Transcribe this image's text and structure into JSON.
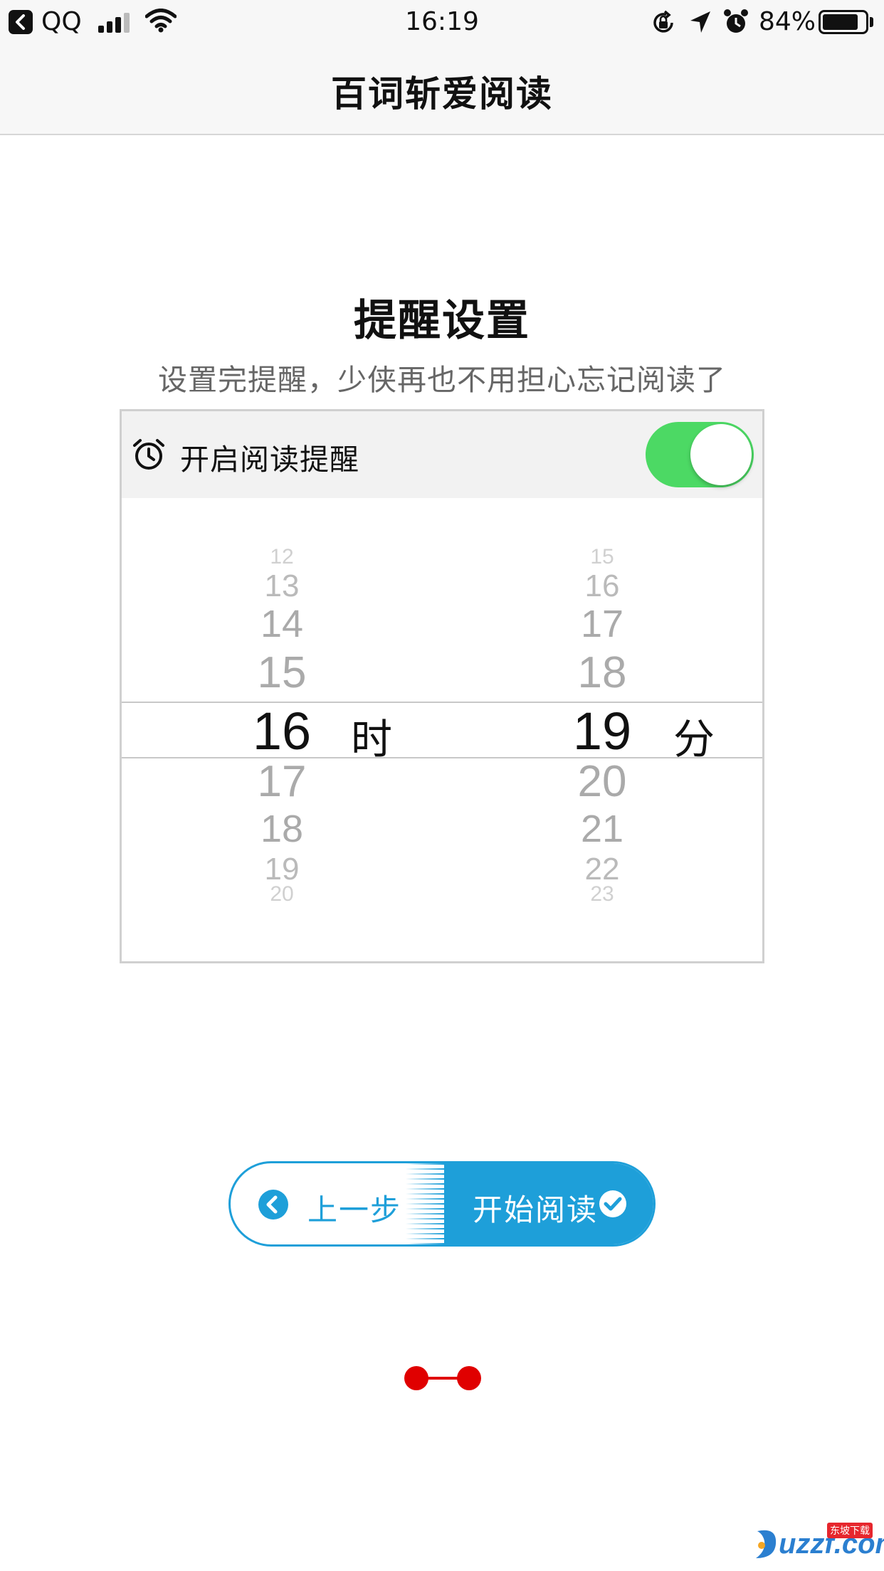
{
  "status_bar": {
    "back_app": "QQ",
    "time": "16:19",
    "battery": "84%",
    "battery_level": 0.84
  },
  "nav": {
    "title": "百词斩爱阅读"
  },
  "heading": "提醒设置",
  "subheading": "设置完提醒，少侠再也不用担心忘记阅读了",
  "reminder": {
    "label": "开启阅读提醒",
    "enabled": true,
    "toggle_color": "#4cd964"
  },
  "picker": {
    "hour_values": [
      "12",
      "13",
      "14",
      "15",
      "16",
      "17",
      "18",
      "19",
      "20"
    ],
    "minute_values": [
      "15",
      "16",
      "17",
      "18",
      "19",
      "20",
      "21",
      "22",
      "23"
    ],
    "selected_hour": "16",
    "selected_minute": "19",
    "hour_unit": "时",
    "minute_unit": "分"
  },
  "buttons": {
    "prev_label": "上一步",
    "start_label": "开始阅读",
    "accent_color": "#1e9fd9"
  },
  "pager": {
    "color": "#e00000"
  },
  "watermark": {
    "text": "uzzf.com",
    "tag": "东坡下载"
  }
}
